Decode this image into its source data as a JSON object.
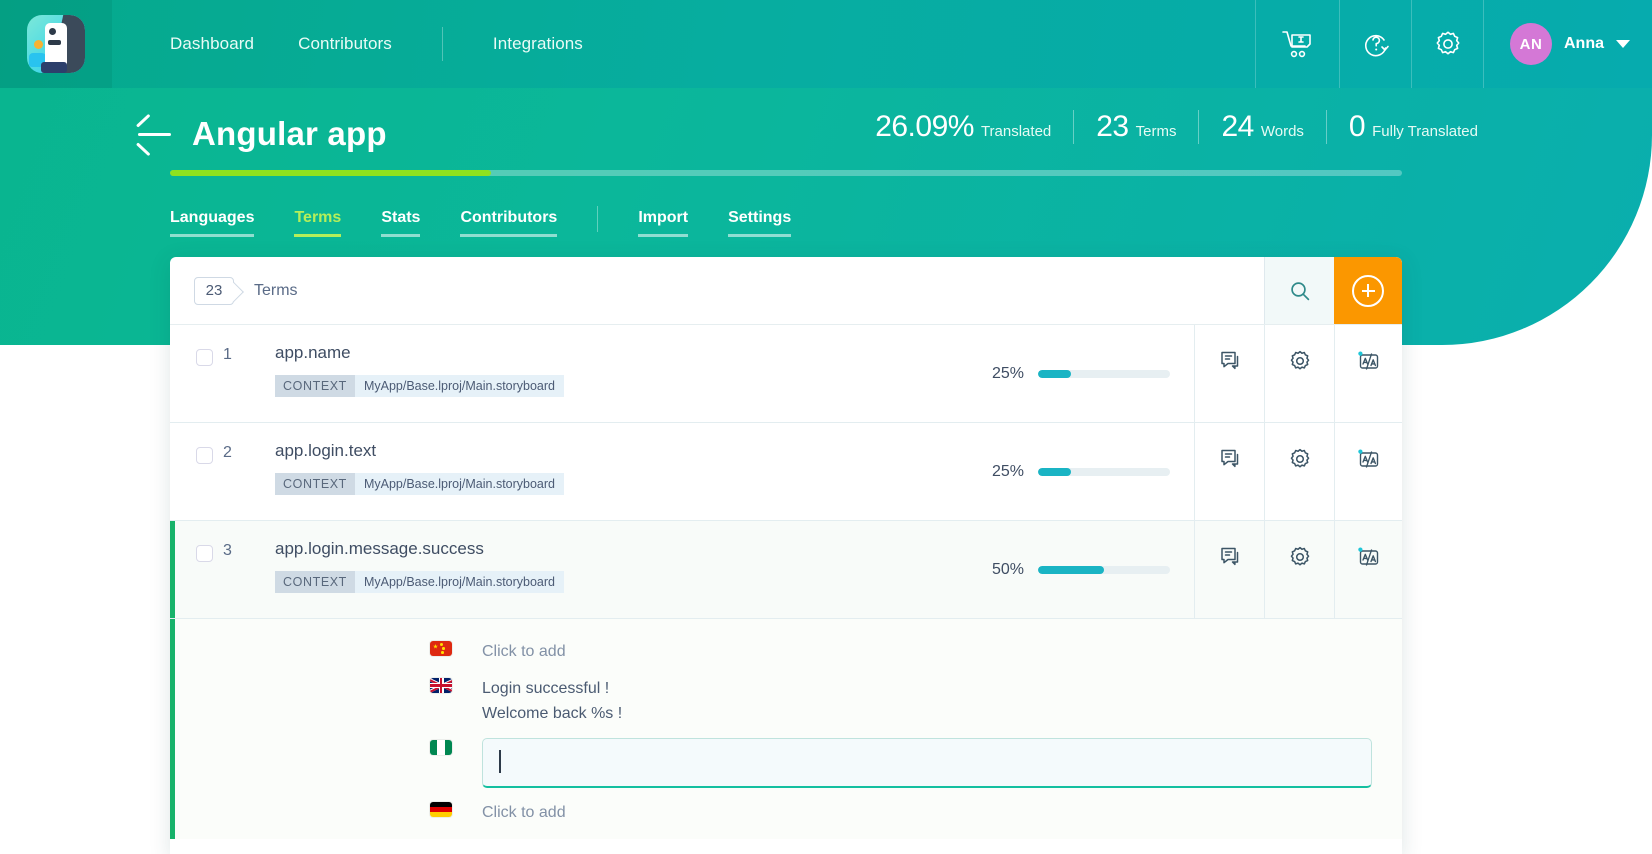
{
  "brand": {
    "logo_name": "poeditor-logo",
    "accent_green": "#09b58f",
    "accent_orange": "#fb9700",
    "accent_lime": "#8fe21e",
    "accent_cyan": "#1ab4c4"
  },
  "topnav": {
    "links": [
      {
        "label": "Dashboard",
        "name": "nav-dashboard"
      },
      {
        "label": "Contributors",
        "name": "nav-contributors"
      },
      {
        "label": "Integrations",
        "name": "nav-integrations"
      }
    ],
    "icons": [
      {
        "name": "cart-icon",
        "title": "cart"
      },
      {
        "name": "help-icon",
        "title": "help"
      },
      {
        "name": "gear-icon",
        "title": "settings"
      }
    ],
    "user": {
      "initials": "AN",
      "name": "Anna"
    }
  },
  "hero": {
    "back_label": "back-arrow",
    "project_title": "Angular app",
    "progress_percent": 26.09,
    "stats": [
      {
        "num": "26.09%",
        "label": "Translated"
      },
      {
        "num": "23",
        "label": "Terms"
      },
      {
        "num": "24",
        "label": "Words"
      },
      {
        "num": "0",
        "label": "Fully Translated"
      }
    ],
    "tabs": [
      {
        "label": "Languages",
        "active": false
      },
      {
        "label": "Terms",
        "active": true
      },
      {
        "label": "Stats",
        "active": false
      },
      {
        "label": "Contributors",
        "active": false
      },
      {
        "label": "Import",
        "active": false
      },
      {
        "label": "Settings",
        "active": false
      }
    ]
  },
  "toolbar": {
    "count": "23",
    "count_word": "Terms",
    "search_name": "search-icon",
    "add_name": "add-term-button"
  },
  "terms": [
    {
      "index": "1",
      "key": "app.name",
      "context_label": "CONTEXT",
      "context_path": "MyApp/Base.lproj/Main.storyboard",
      "percent_label": "25%",
      "percent": 25,
      "selected": false
    },
    {
      "index": "2",
      "key": "app.login.text",
      "context_label": "CONTEXT",
      "context_path": "MyApp/Base.lproj/Main.storyboard",
      "percent_label": "25%",
      "percent": 25,
      "selected": false
    },
    {
      "index": "3",
      "key": "app.login.message.success",
      "context_label": "CONTEXT",
      "context_path": "MyApp/Base.lproj/Main.storyboard",
      "percent_label": "50%",
      "percent": 50,
      "selected": true
    }
  ],
  "translations": [
    {
      "flag": "flag-cn",
      "flag_name": "china-flag",
      "type": "empty",
      "text": "Click to add"
    },
    {
      "flag": "flag-gb",
      "flag_name": "uk-flag",
      "type": "text",
      "line1": "Login successful !",
      "line2": "Welcome back %s !"
    },
    {
      "flag": "flag-ng",
      "flag_name": "nigeria-flag",
      "type": "editor",
      "value": ""
    },
    {
      "flag": "flag-de",
      "flag_name": "germany-flag",
      "type": "empty",
      "text": "Click to add"
    }
  ]
}
